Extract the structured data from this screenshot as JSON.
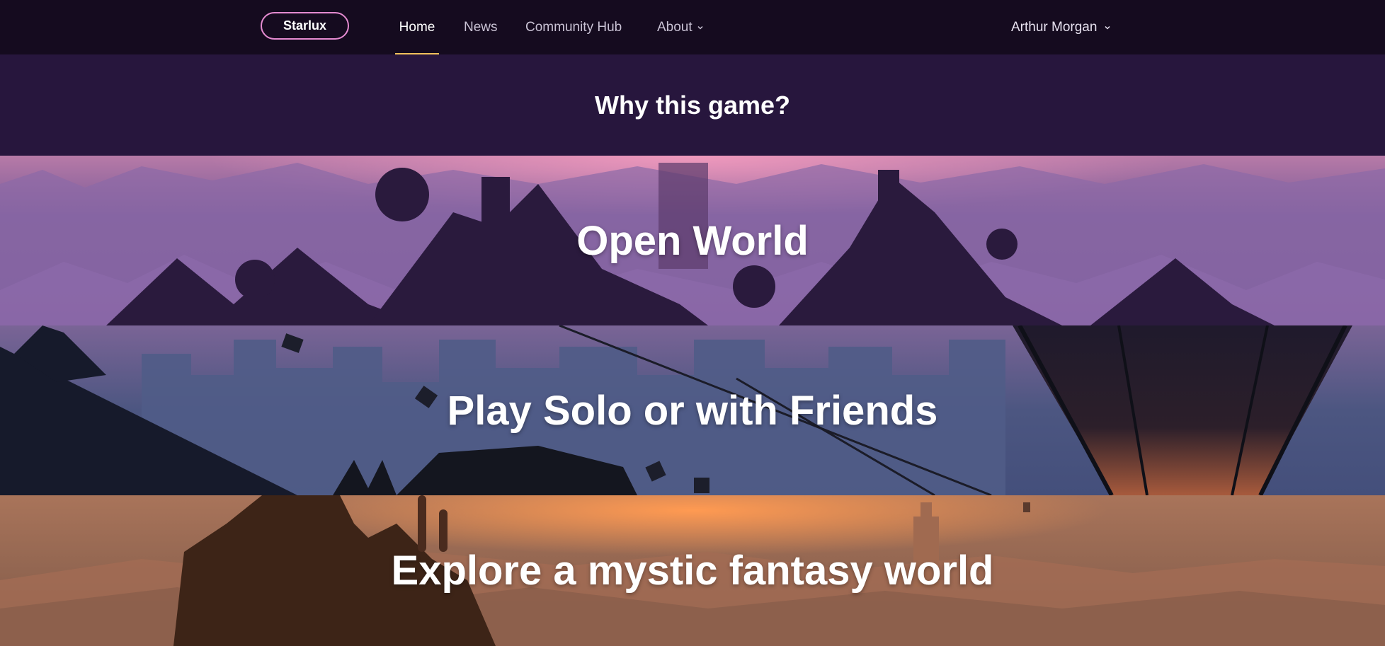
{
  "nav": {
    "brand": "Starlux",
    "links": [
      {
        "label": "Home",
        "active": true
      },
      {
        "label": "News",
        "active": false
      },
      {
        "label": "Community Hub",
        "active": false
      },
      {
        "label": "About",
        "active": false
      }
    ],
    "user": "Arthur Morgan",
    "accent_color": "#f1c15a",
    "brand_border_color": "#e58bd1",
    "dropdown_icon": "chevron-down-icon"
  },
  "why": {
    "title": "Why this game?"
  },
  "features": [
    {
      "title": "Open World"
    },
    {
      "title": "Play Solo or with Friends"
    },
    {
      "title": "Explore a mystic fantasy world"
    }
  ]
}
